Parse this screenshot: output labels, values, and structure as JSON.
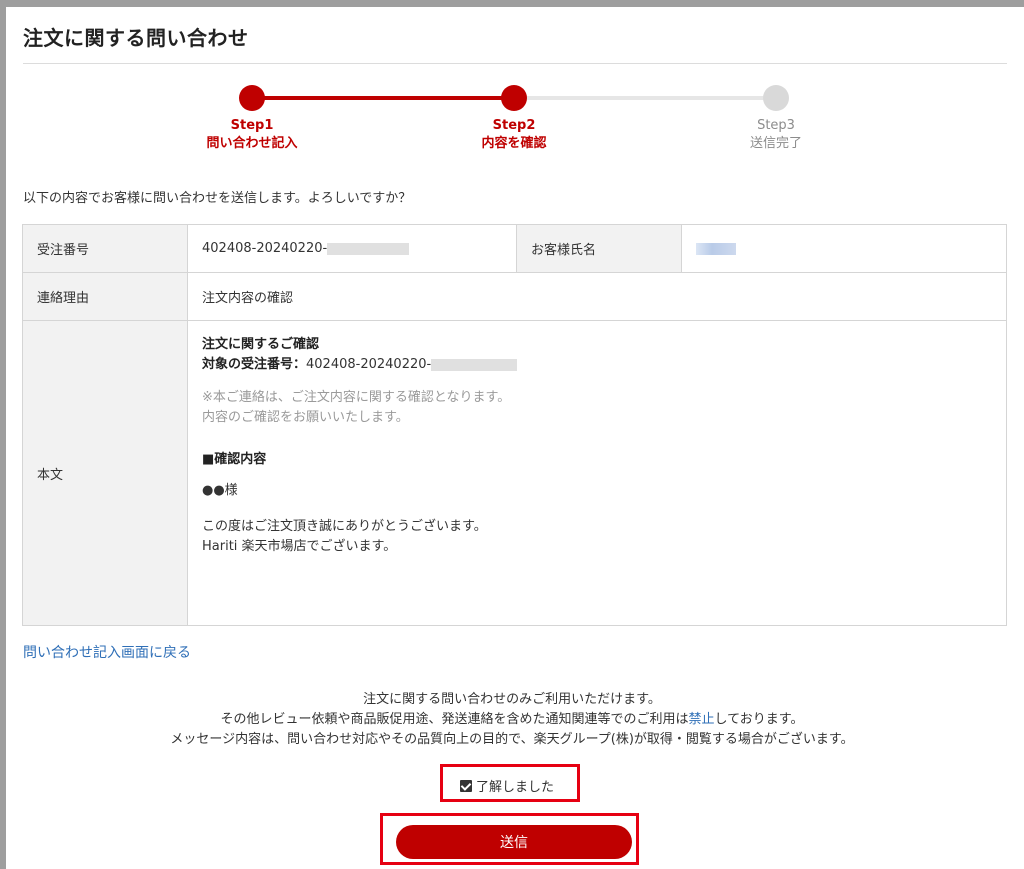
{
  "page": {
    "title": "注文に関する問い合わせ"
  },
  "steps": [
    {
      "step": "Step1",
      "label": "問い合わせ記入",
      "state": "done"
    },
    {
      "step": "Step2",
      "label": "内容を確認",
      "state": "current"
    },
    {
      "step": "Step3",
      "label": "送信完了",
      "state": "pending"
    }
  ],
  "intro": "以下の内容でお客様に問い合わせを送信します。よろしいですか？",
  "table": {
    "order_number_label": "受注番号",
    "order_number_value": "402408-20240220-",
    "customer_name_label": "お客様氏名",
    "reason_label": "連絡理由",
    "reason_value": "注文内容の確認",
    "body_label": "本文",
    "body": {
      "heading": "注文に関するご確認",
      "target_label": "対象の受注番号：",
      "target_value": "402408-20240220-",
      "note_line1": "※本ご連絡は、ご注文内容に関する確認となります。",
      "note_line2": "内容のご確認をお願いいたします。",
      "section_heading": "■確認内容",
      "salutation": "●●様",
      "message_line1": "この度はご注文頂き誠にありがとうございます。",
      "message_line2": "Hariti 楽天市場店でございます。"
    }
  },
  "back_link": "問い合わせ記入画面に戻る",
  "notice": {
    "line1": "注文に関する問い合わせのみご利用いただけます。",
    "line2_before": "その他レビュー依頼や商品販促用途、発送連絡を含めた通知関連等でのご利用は",
    "line2_link": "禁止",
    "line2_after": "しております。",
    "line3": "メッセージ内容は、問い合わせ対応やその品質向上の目的で、楽天グループ(株)が取得・閲覧する場合がございます。"
  },
  "agree": {
    "label": "了解しました",
    "checked": true
  },
  "submit_label": "送信",
  "colors": {
    "accent": "#bf0000",
    "link": "#2f6fb7",
    "highlight_box": "#e60012",
    "inactive": "#d9d9d9"
  }
}
